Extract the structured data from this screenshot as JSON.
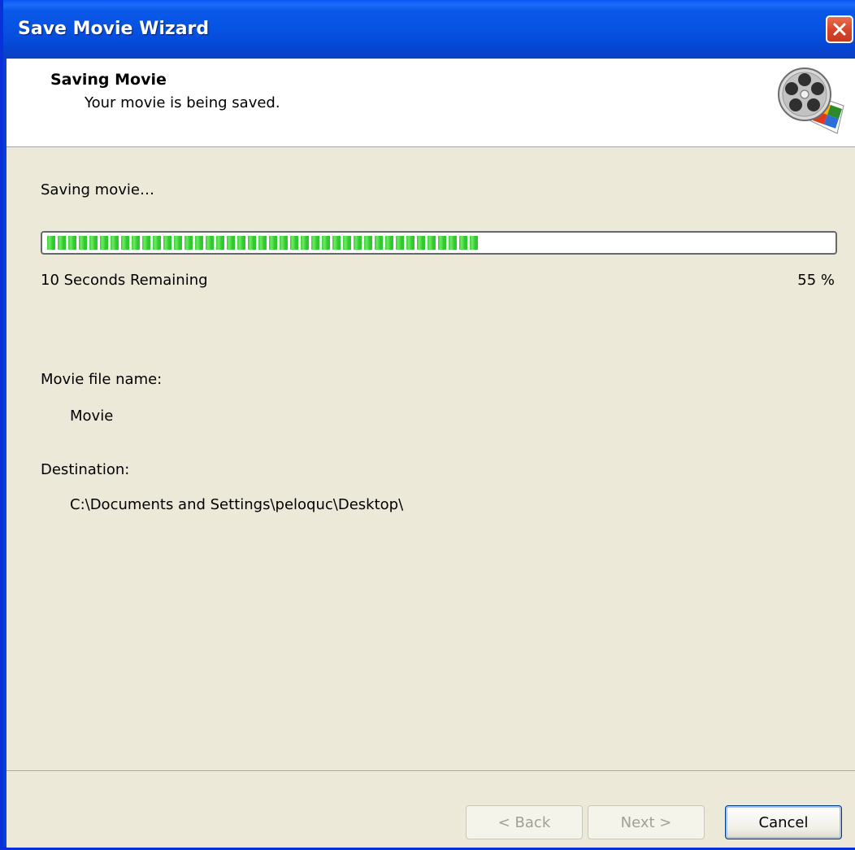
{
  "window": {
    "title": "Save Movie Wizard"
  },
  "header": {
    "title": "Saving Movie",
    "subtitle": "Your movie is being saved.",
    "icon": "movie-maker-film-reel-icon"
  },
  "progress": {
    "status_label": "Saving movie…",
    "remaining_label": "10 Seconds Remaining",
    "percent_label": "55 %",
    "percent_value": 55
  },
  "details": {
    "file_name_label": "Movie file name:",
    "file_name_value": "Movie",
    "destination_label": "Destination:",
    "destination_value": "C:\\Documents and Settings\\peloquc\\Desktop\\"
  },
  "buttons": {
    "back_label": "< Back",
    "next_label": "Next >",
    "cancel_label": "Cancel"
  },
  "colors": {
    "titlebar": "#0653e2",
    "progress_fill": "#38d23a",
    "dialog_background": "#ece9d8",
    "close_button": "#d8462a"
  }
}
